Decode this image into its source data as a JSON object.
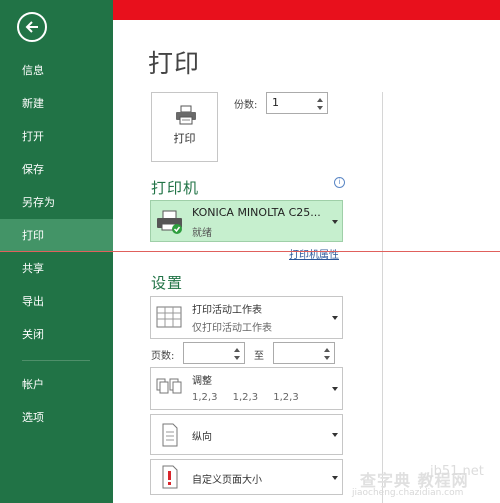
{
  "sidebar": {
    "items": [
      {
        "label": "信息"
      },
      {
        "label": "新建"
      },
      {
        "label": "打开"
      },
      {
        "label": "保存"
      },
      {
        "label": "另存为"
      },
      {
        "label": "打印"
      },
      {
        "label": "共享"
      },
      {
        "label": "导出"
      },
      {
        "label": "关闭"
      },
      {
        "label": "帐户"
      },
      {
        "label": "选项"
      }
    ]
  },
  "main": {
    "title": "打印",
    "print_button_label": "打印",
    "copies_label": "份数:",
    "copies_value": "1",
    "printer_section_title": "打印机",
    "printer_name": "KONICA MINOLTA C25...",
    "printer_status": "就绪",
    "printer_properties_link": "打印机属性",
    "settings_section_title": "设置",
    "print_what": {
      "title": "打印活动工作表",
      "subtitle": "仅打印活动工作表"
    },
    "pages_label": "页数:",
    "pages_to_label": "至",
    "collate": {
      "title": "调整",
      "nums": "1,2,3 1,2,3 1,2,3"
    },
    "orientation": {
      "title": "纵向"
    },
    "paper_size": {
      "title": "自定义页面大小"
    }
  },
  "watermark": {
    "text": "查字典 教程网",
    "url": "jiaocheng.chazidian.com",
    "site": "jb51.net"
  },
  "colors": {
    "sidebar_bg": "#217346",
    "sidebar_active": "#439467",
    "accent_green": "#217346",
    "printer_selected_bg": "#c6efce",
    "top_band_red": "#e8101c"
  }
}
